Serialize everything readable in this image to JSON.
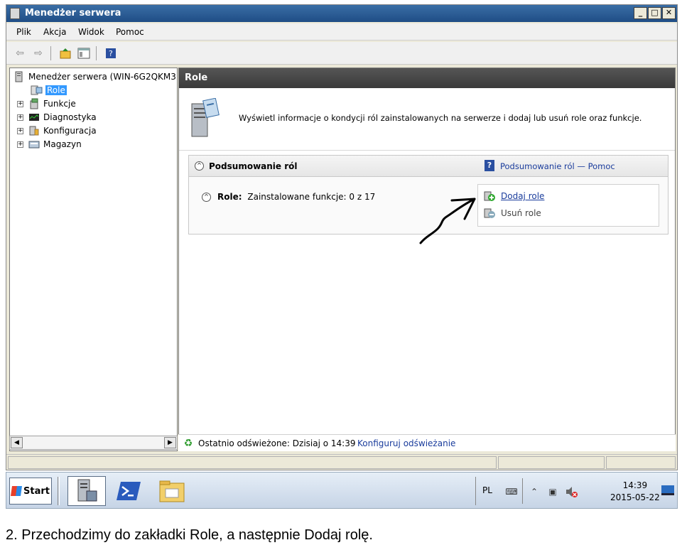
{
  "window": {
    "title": "Menedżer serwera",
    "controls": {
      "minimize": "_",
      "maximize": "□",
      "close": "✕"
    }
  },
  "menu": [
    "Plik",
    "Akcja",
    "Widok",
    "Pomoc"
  ],
  "tree": {
    "root": "Menedżer serwera (WIN-6G2QKM3",
    "items": [
      {
        "label": "Role",
        "expander": ""
      },
      {
        "label": "Funkcje",
        "expander": "+"
      },
      {
        "label": "Diagnostyka",
        "expander": "+"
      },
      {
        "label": "Konfiguracja",
        "expander": "+"
      },
      {
        "label": "Magazyn",
        "expander": "+"
      }
    ]
  },
  "scrollbar": {
    "left_arrow": "◀",
    "right_arrow": "▶"
  },
  "content": {
    "header": "Role",
    "info_text": "Wyświetl informacje o kondycji ról zainstalowanych na serwerze i dodaj lub usuń role oraz funkcje.",
    "summary": {
      "collapse_glyph": "^",
      "title": "Podsumowanie ról",
      "help_glyph": "?",
      "help_link": "Podsumowanie ról — Pomoc",
      "role_label": "Role:",
      "role_value": "Zainstalowane funkcje: 0 z 17",
      "actions": {
        "add": "Dodaj role",
        "remove": "Usuń role"
      }
    },
    "refresh": {
      "text": "Ostatnio odświeżone: Dzisiaj o 14:39",
      "link": "Konfiguruj odświeżanie"
    }
  },
  "taskbar": {
    "start": "Start",
    "lang": "PL",
    "time": "14:39",
    "date": "2015-05-22"
  },
  "caption": "2. Przechodzimy do zakładki Role, a następnie Dodaj rolę."
}
